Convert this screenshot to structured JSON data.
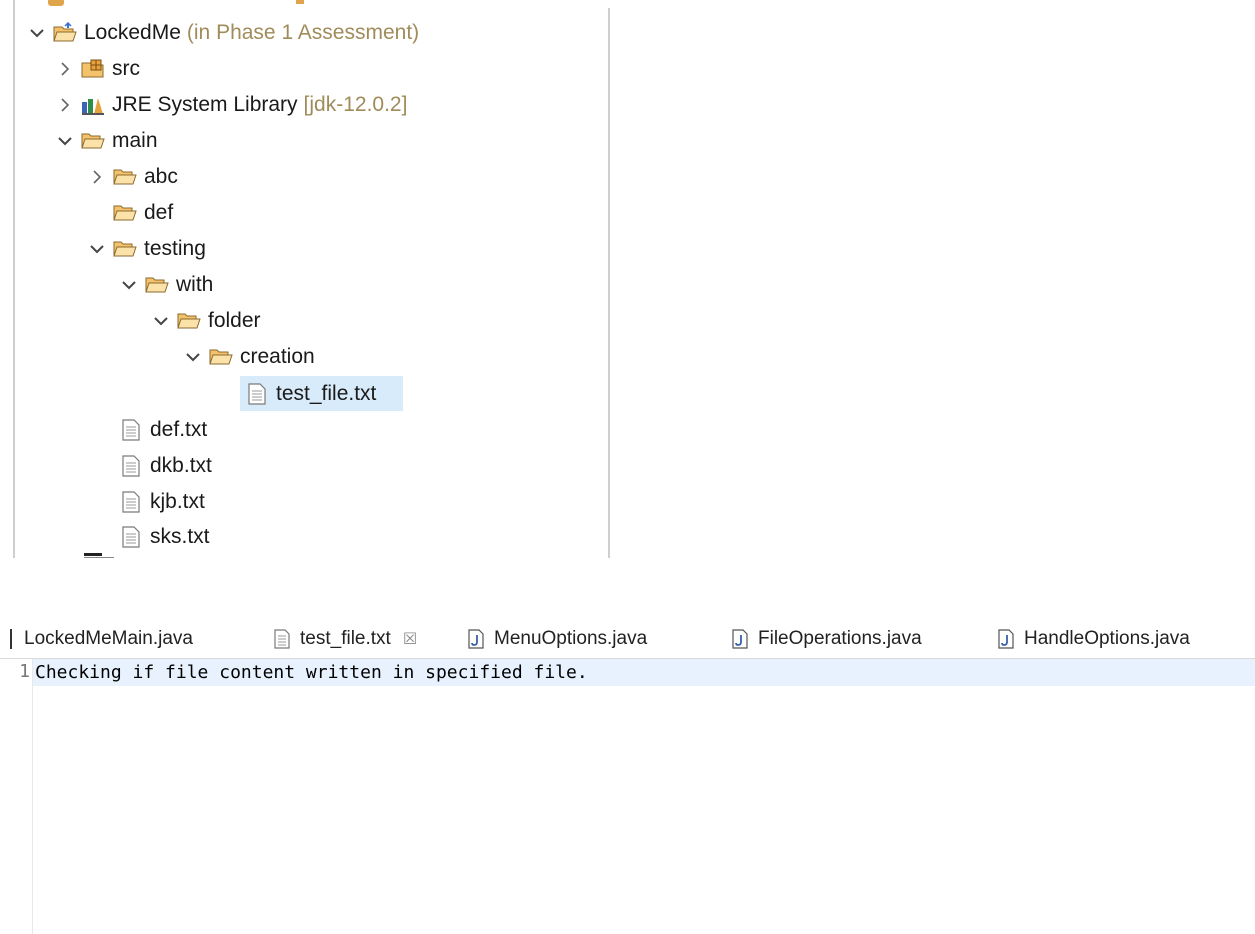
{
  "explorer": {
    "project": {
      "name": "LockedMe",
      "decoration": "(in Phase 1 Assessment)"
    },
    "items": [
      {
        "label": "src",
        "icon": "package-folder-icon"
      },
      {
        "label": "JRE System Library",
        "decoration": "[jdk-12.0.2]",
        "icon": "library-icon"
      },
      {
        "label": "main",
        "icon": "folder-open-icon"
      },
      {
        "label": "abc",
        "icon": "folder-icon"
      },
      {
        "label": "def",
        "icon": "folder-icon"
      },
      {
        "label": "testing",
        "icon": "folder-icon"
      },
      {
        "label": "with",
        "icon": "folder-icon"
      },
      {
        "label": "folder",
        "icon": "folder-icon"
      },
      {
        "label": "creation",
        "icon": "folder-icon"
      },
      {
        "label": "test_file.txt",
        "icon": "text-file-icon",
        "selected": true
      },
      {
        "label": "def.txt",
        "icon": "text-file-icon"
      },
      {
        "label": "dkb.txt",
        "icon": "text-file-icon"
      },
      {
        "label": "kjb.txt",
        "icon": "text-file-icon"
      },
      {
        "label": "sks.txt",
        "icon": "text-file-icon"
      }
    ]
  },
  "editor": {
    "tabs": [
      {
        "label": "LockedMeMain.java"
      },
      {
        "label": "test_file.txt",
        "active": true,
        "close": "☒"
      },
      {
        "label": "MenuOptions.java"
      },
      {
        "label": "FileOperations.java"
      },
      {
        "label": "HandleOptions.java"
      }
    ],
    "lines": [
      {
        "number": "1",
        "text": "Checking if file content written in specified file."
      }
    ]
  },
  "colors": {
    "selection": "#d7ebfa",
    "current_line": "#e8f2fe",
    "folder": "#e0a44a",
    "decoration": "#a08c5a"
  }
}
